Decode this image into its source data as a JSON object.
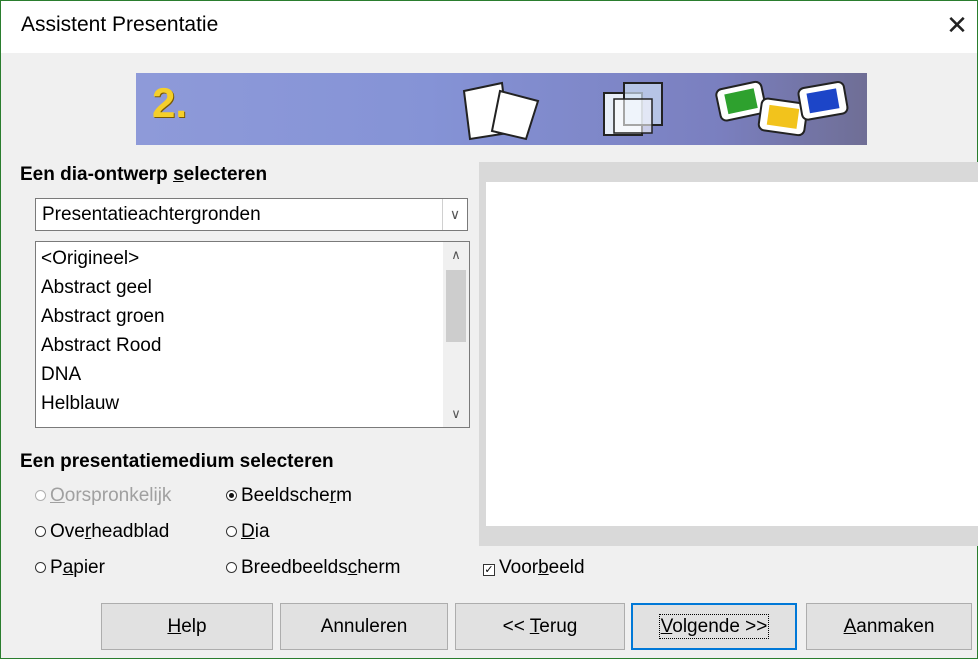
{
  "window": {
    "title": "Assistent Presentatie",
    "close_glyph": "✕"
  },
  "banner": {
    "step": "2.",
    "icons": [
      "stacked-pages-icon",
      "overlapping-transparent-frames-icon",
      "colored-slides-icon"
    ]
  },
  "design": {
    "heading_pre": "Een dia-ontwerp ",
    "heading_u": "s",
    "heading_post": "electeren",
    "category_value": "Presentatieachtergronden",
    "items": [
      "<Origineel>",
      "Abstract geel",
      "Abstract groen",
      "Abstract Rood",
      "DNA",
      "Helblauw"
    ]
  },
  "medium": {
    "heading": "Een presentatiemedium selecteren",
    "options": [
      {
        "pre": "",
        "u": "O",
        "post": "orspronkelijk",
        "checked": false,
        "disabled": true
      },
      {
        "pre": "Beeldsche",
        "u": "r",
        "post": "m",
        "checked": true,
        "disabled": false
      },
      {
        "pre": "Ove",
        "u": "r",
        "post": "headblad",
        "checked": false,
        "disabled": false
      },
      {
        "pre": "",
        "u": "D",
        "post": "ia",
        "checked": false,
        "disabled": false
      },
      {
        "pre": "P",
        "u": "a",
        "post": "pier",
        "checked": false,
        "disabled": false
      },
      {
        "pre": "Breedbeelds",
        "u": "c",
        "post": "herm",
        "checked": false,
        "disabled": false
      }
    ]
  },
  "preview_checkbox": {
    "pre": "Voor",
    "u": "b",
    "post": "eeld",
    "checked": true,
    "glyph": "✓"
  },
  "buttons": {
    "help": {
      "pre": "",
      "u": "H",
      "post": "elp"
    },
    "cancel": {
      "pre": "Annuleren",
      "u": "",
      "post": ""
    },
    "back": {
      "pre": "<< ",
      "u": "T",
      "post": "erug"
    },
    "next": {
      "pre": "",
      "u": "V",
      "post": "olgende >>"
    },
    "create": {
      "pre": "",
      "u": "A",
      "post": "anmaken"
    }
  }
}
